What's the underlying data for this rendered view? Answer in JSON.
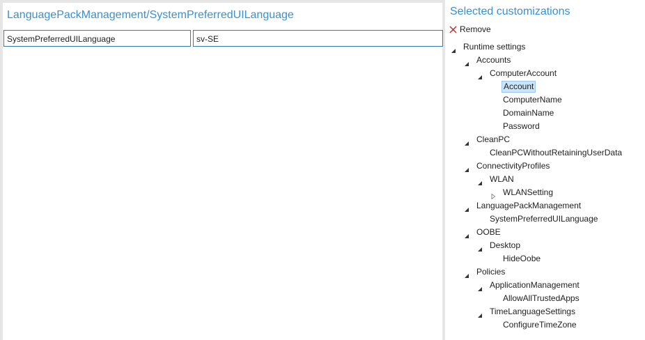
{
  "editor": {
    "path_title": "LanguagePackManagement/SystemPreferredUILanguage",
    "setting_name": "SystemPreferredUILanguage",
    "setting_value": "sv-SE"
  },
  "customizations": {
    "title": "Selected customizations",
    "remove_label": "Remove",
    "tree": [
      {
        "label": "Runtime settings",
        "level": 0,
        "toggle": "expanded"
      },
      {
        "label": "Accounts",
        "level": 1,
        "toggle": "expanded"
      },
      {
        "label": "ComputerAccount",
        "level": 2,
        "toggle": "expanded"
      },
      {
        "label": "Account",
        "level": 3,
        "toggle": "none",
        "selected": true
      },
      {
        "label": "ComputerName",
        "level": 3,
        "toggle": "none"
      },
      {
        "label": "DomainName",
        "level": 3,
        "toggle": "none"
      },
      {
        "label": "Password",
        "level": 3,
        "toggle": "none"
      },
      {
        "label": "CleanPC",
        "level": 1,
        "toggle": "expanded"
      },
      {
        "label": "CleanPCWithoutRetainingUserData",
        "level": 2,
        "toggle": "none"
      },
      {
        "label": "ConnectivityProfiles",
        "level": 1,
        "toggle": "expanded"
      },
      {
        "label": "WLAN",
        "level": 2,
        "toggle": "expanded"
      },
      {
        "label": "WLANSetting",
        "level": 3,
        "toggle": "collapsed"
      },
      {
        "label": "LanguagePackManagement",
        "level": 1,
        "toggle": "expanded"
      },
      {
        "label": "SystemPreferredUILanguage",
        "level": 2,
        "toggle": "none"
      },
      {
        "label": "OOBE",
        "level": 1,
        "toggle": "expanded"
      },
      {
        "label": "Desktop",
        "level": 2,
        "toggle": "expanded"
      },
      {
        "label": "HideOobe",
        "level": 3,
        "toggle": "none"
      },
      {
        "label": "Policies",
        "level": 1,
        "toggle": "expanded"
      },
      {
        "label": "ApplicationManagement",
        "level": 2,
        "toggle": "expanded"
      },
      {
        "label": "AllowAllTrustedApps",
        "level": 3,
        "toggle": "none"
      },
      {
        "label": "TimeLanguageSettings",
        "level": 2,
        "toggle": "expanded"
      },
      {
        "label": "ConfigureTimeZone",
        "level": 3,
        "toggle": "none"
      }
    ]
  }
}
